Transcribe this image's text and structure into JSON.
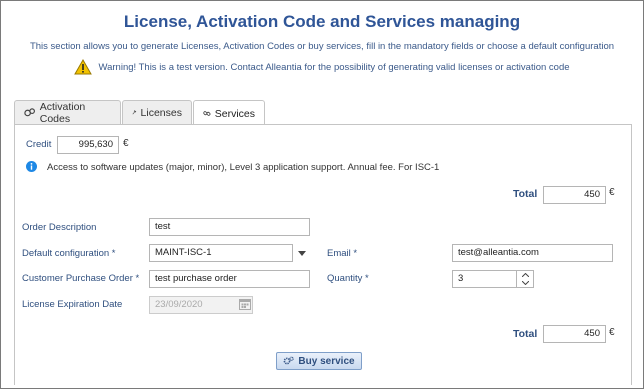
{
  "header": {
    "title": "License, Activation Code and Services managing",
    "subtitle": "This section allows you to generate Licenses, Activation Codes or buy services, fill in the mandatory fields or choose a default configuration",
    "warning": "Warning! This is a test version. Contact Alleantia for the possibility of generating valid licenses or activation code",
    "warning_icon": "warning-triangle-icon"
  },
  "tabs": [
    {
      "label": "Activation Codes",
      "icon": "activation-code-icon",
      "active": false
    },
    {
      "label": "Licenses",
      "icon": "gavel-icon",
      "active": false
    },
    {
      "label": "Services",
      "icon": "link-icon",
      "active": true
    }
  ],
  "credit": {
    "label": "Credit",
    "value": "995,630",
    "currency": "€"
  },
  "info": {
    "text": "Access to software updates (major, minor), Level 3 application support. Annual fee. For ISC-1",
    "icon": "info-icon"
  },
  "total_top": {
    "label": "Total",
    "value": "450",
    "currency": "€"
  },
  "form": {
    "order_description": {
      "label": "Order Description",
      "value": "test"
    },
    "default_configuration": {
      "label": "Default configuration *",
      "value": "MAINT-ISC-1"
    },
    "email": {
      "label": "Email *",
      "value": "test@alleantia.com"
    },
    "customer_po": {
      "label": "Customer Purchase Order *",
      "value": "test purchase order"
    },
    "quantity": {
      "label": "Quantity *",
      "value": "3"
    },
    "expiration": {
      "label": "License Expiration Date",
      "placeholder": "23/09/2020"
    }
  },
  "total_bottom": {
    "label": "Total",
    "value": "450",
    "currency": "€"
  },
  "buy_button": {
    "label": "Buy service",
    "icon": "gears-icon"
  },
  "colors": {
    "title": "#2f5597",
    "label": "#2f4f7f",
    "info": "#1e88e5",
    "warning": "#f2c200"
  }
}
